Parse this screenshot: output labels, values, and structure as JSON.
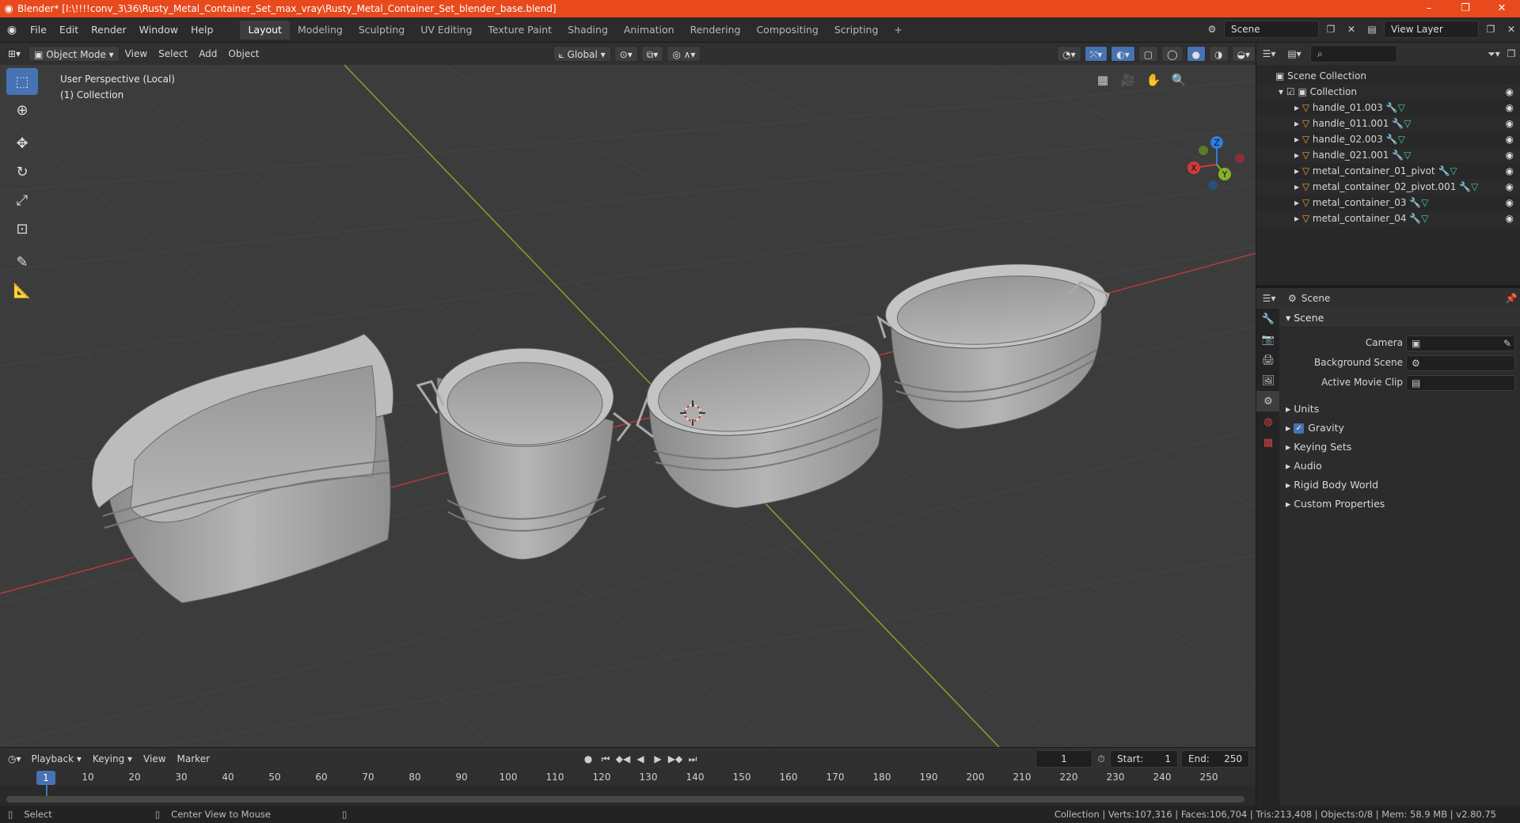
{
  "titlebar": {
    "title": "Blender* [I:\\!!!!conv_3\\36\\Rusty_Metal_Container_Set_max_vray\\Rusty_Metal_Container_Set_blender_base.blend]",
    "minimize": "–",
    "restore": "❐",
    "close": "✕"
  },
  "menu": [
    "File",
    "Edit",
    "Render",
    "Window",
    "Help"
  ],
  "workspaces": [
    "Layout",
    "Modeling",
    "Sculpting",
    "UV Editing",
    "Texture Paint",
    "Shading",
    "Animation",
    "Rendering",
    "Compositing",
    "Scripting"
  ],
  "workspace_add": "+",
  "scene_field": "Scene",
  "view_layer_field": "View Layer",
  "viewport_header": {
    "mode": "Object Mode",
    "menus": [
      "View",
      "Select",
      "Add",
      "Object"
    ],
    "transform": "Global"
  },
  "viewport": {
    "perspective": "User Perspective (Local)",
    "collection": "(1) Collection"
  },
  "gizmo": {
    "x": "X",
    "y": "Y",
    "z": "Z"
  },
  "timeline_header": {
    "menus": [
      "Playback",
      "Keying",
      "View",
      "Marker"
    ],
    "current_frame": "1",
    "start_label": "Start:",
    "start_value": "1",
    "end_label": "End:",
    "end_value": "250"
  },
  "timeline": {
    "current": "1",
    "ticks": [
      "10",
      "20",
      "30",
      "40",
      "50",
      "60",
      "70",
      "80",
      "90",
      "100",
      "110",
      "120",
      "130",
      "140",
      "150",
      "160",
      "170",
      "180",
      "190",
      "200",
      "210",
      "220",
      "230",
      "240",
      "250"
    ]
  },
  "statusbar": {
    "select": "Select",
    "center_view": "Center View to Mouse",
    "stats": "Collection | Verts:107,316 | Faces:106,704 | Tris:213,408 | Objects:0/8 | Mem: 58.9 MB | v2.80.75"
  },
  "outliner": {
    "root": "Scene Collection",
    "collection": "Collection",
    "objects": [
      "handle_01.003",
      "handle_011.001",
      "handle_02.003",
      "handle_021.001",
      "metal_container_01_pivot",
      "metal_container_02_pivot.001",
      "metal_container_03",
      "metal_container_04"
    ]
  },
  "properties": {
    "header": "Scene",
    "panel": "Scene",
    "camera_label": "Camera",
    "background_scene_label": "Background Scene",
    "active_movie_clip_label": "Active Movie Clip",
    "subpanels": [
      "Units",
      "Gravity",
      "Keying Sets",
      "Audio",
      "Rigid Body World",
      "Custom Properties"
    ]
  },
  "colors": {
    "titlebar": "#e8491d",
    "accent": "#4772b3",
    "viewport": "#3c3c3c",
    "x_axis": "#d03a3a",
    "y_axis": "#86b32a"
  }
}
